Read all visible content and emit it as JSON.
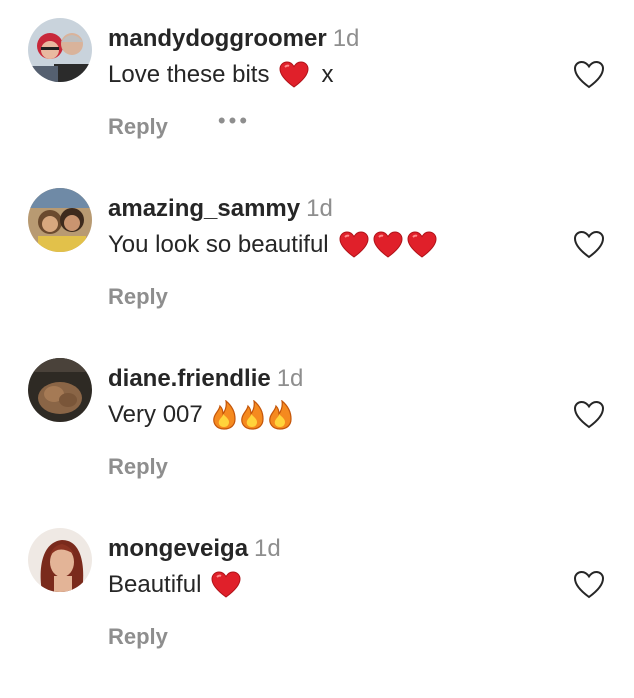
{
  "comments": [
    {
      "username": "mandydoggroomer",
      "time": "1d",
      "text": "Love these bits",
      "emojis": [
        "red-heart"
      ],
      "suffix": "x",
      "reply_label": "Reply",
      "more_label": "•••",
      "avatar": "avatar-mandydoggroomer"
    },
    {
      "username": "amazing_sammy",
      "time": "1d",
      "text": "You look so beautiful",
      "emojis": [
        "red-heart",
        "red-heart",
        "red-heart"
      ],
      "reply_label": "Reply",
      "avatar": "avatar-amazing-sammy"
    },
    {
      "username": "diane.friendlie",
      "time": "1d",
      "text": "Very 007",
      "emojis": [
        "fire",
        "fire",
        "fire"
      ],
      "reply_label": "Reply",
      "avatar": "avatar-diane-friendlie"
    },
    {
      "username": "mongeveiga",
      "time": "1d",
      "text": "Beautiful",
      "emojis": [
        "red-heart"
      ],
      "reply_label": "Reply",
      "avatar": "avatar-mongeveiga"
    }
  ],
  "icons": {
    "like": "heart-outline-icon",
    "heart_emoji": "red-heart-emoji",
    "fire_emoji": "fire-emoji"
  },
  "colors": {
    "username": "#262626",
    "meta": "#8e8e8e",
    "heart": "#e0202a",
    "fire": "#f58a1f"
  }
}
